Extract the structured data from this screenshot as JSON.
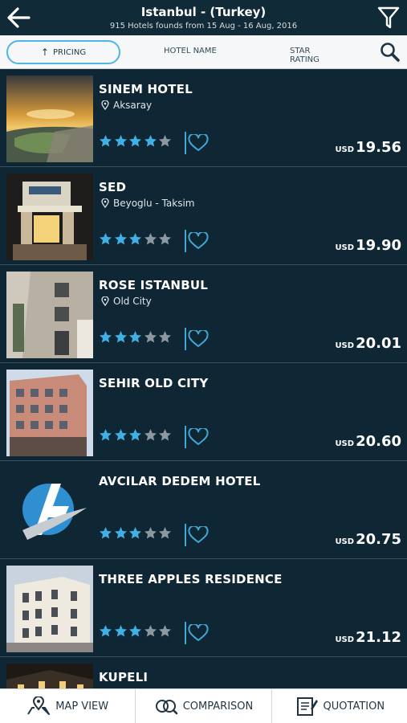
{
  "header": {
    "title": "Istanbul - (Turkey)",
    "subtitle": "915 Hotels founds from 15 Aug - 16 Aug, 2016"
  },
  "sortbar": {
    "pricing_label": "PRICING",
    "hotel_name_label": "HOTEL NAME",
    "star_rating_label": "STAR RATING"
  },
  "colors": {
    "star_on": "#3eb0e4",
    "star_off": "#8b98a0",
    "accent": "#4fb6e3"
  },
  "hotels": [
    {
      "name": "SINEM HOTEL",
      "location": "Aksaray",
      "stars": 4,
      "currency": "USD",
      "price": "19.56"
    },
    {
      "name": "SED",
      "location": "Beyoglu - Taksim",
      "stars": 3,
      "currency": "USD",
      "price": "19.90"
    },
    {
      "name": "ROSE ISTANBUL",
      "location": "Old City",
      "stars": 3,
      "currency": "USD",
      "price": "20.01"
    },
    {
      "name": "SEHIR OLD CITY",
      "location": "",
      "stars": 3,
      "currency": "USD",
      "price": "20.60"
    },
    {
      "name": "AVCILAR DEDEM HOTEL",
      "location": "",
      "stars": 3,
      "currency": "USD",
      "price": "20.75"
    },
    {
      "name": "THREE APPLES RESIDENCE",
      "location": "",
      "stars": 3,
      "currency": "USD",
      "price": "21.12"
    },
    {
      "name": "KUPELI",
      "location": "",
      "stars": 0,
      "currency": "",
      "price": ""
    }
  ],
  "bottombar": {
    "map_view_label": "MAP VIEW",
    "comparison_label": "COMPARISON",
    "quotation_label": "QUOTATION"
  }
}
